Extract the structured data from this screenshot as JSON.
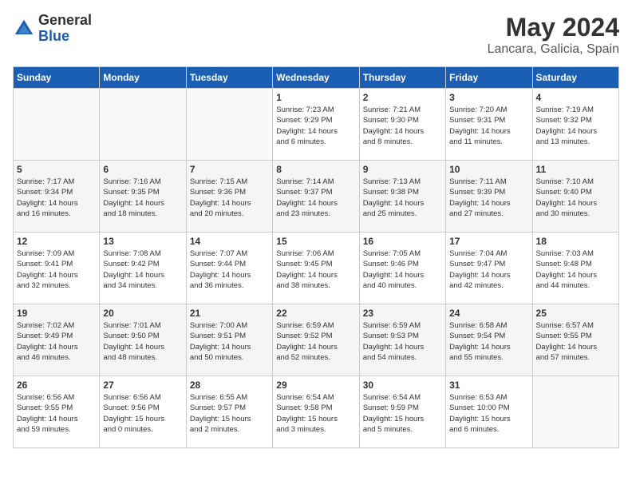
{
  "header": {
    "logo_general": "General",
    "logo_blue": "Blue",
    "main_title": "May 2024",
    "subtitle": "Lancara, Galicia, Spain"
  },
  "calendar": {
    "days_of_week": [
      "Sunday",
      "Monday",
      "Tuesday",
      "Wednesday",
      "Thursday",
      "Friday",
      "Saturday"
    ],
    "weeks": [
      [
        {
          "day": "",
          "info": ""
        },
        {
          "day": "",
          "info": ""
        },
        {
          "day": "",
          "info": ""
        },
        {
          "day": "1",
          "info": "Sunrise: 7:23 AM\nSunset: 9:29 PM\nDaylight: 14 hours\nand 6 minutes."
        },
        {
          "day": "2",
          "info": "Sunrise: 7:21 AM\nSunset: 9:30 PM\nDaylight: 14 hours\nand 8 minutes."
        },
        {
          "day": "3",
          "info": "Sunrise: 7:20 AM\nSunset: 9:31 PM\nDaylight: 14 hours\nand 11 minutes."
        },
        {
          "day": "4",
          "info": "Sunrise: 7:19 AM\nSunset: 9:32 PM\nDaylight: 14 hours\nand 13 minutes."
        }
      ],
      [
        {
          "day": "5",
          "info": "Sunrise: 7:17 AM\nSunset: 9:34 PM\nDaylight: 14 hours\nand 16 minutes."
        },
        {
          "day": "6",
          "info": "Sunrise: 7:16 AM\nSunset: 9:35 PM\nDaylight: 14 hours\nand 18 minutes."
        },
        {
          "day": "7",
          "info": "Sunrise: 7:15 AM\nSunset: 9:36 PM\nDaylight: 14 hours\nand 20 minutes."
        },
        {
          "day": "8",
          "info": "Sunrise: 7:14 AM\nSunset: 9:37 PM\nDaylight: 14 hours\nand 23 minutes."
        },
        {
          "day": "9",
          "info": "Sunrise: 7:13 AM\nSunset: 9:38 PM\nDaylight: 14 hours\nand 25 minutes."
        },
        {
          "day": "10",
          "info": "Sunrise: 7:11 AM\nSunset: 9:39 PM\nDaylight: 14 hours\nand 27 minutes."
        },
        {
          "day": "11",
          "info": "Sunrise: 7:10 AM\nSunset: 9:40 PM\nDaylight: 14 hours\nand 30 minutes."
        }
      ],
      [
        {
          "day": "12",
          "info": "Sunrise: 7:09 AM\nSunset: 9:41 PM\nDaylight: 14 hours\nand 32 minutes."
        },
        {
          "day": "13",
          "info": "Sunrise: 7:08 AM\nSunset: 9:42 PM\nDaylight: 14 hours\nand 34 minutes."
        },
        {
          "day": "14",
          "info": "Sunrise: 7:07 AM\nSunset: 9:44 PM\nDaylight: 14 hours\nand 36 minutes."
        },
        {
          "day": "15",
          "info": "Sunrise: 7:06 AM\nSunset: 9:45 PM\nDaylight: 14 hours\nand 38 minutes."
        },
        {
          "day": "16",
          "info": "Sunrise: 7:05 AM\nSunset: 9:46 PM\nDaylight: 14 hours\nand 40 minutes."
        },
        {
          "day": "17",
          "info": "Sunrise: 7:04 AM\nSunset: 9:47 PM\nDaylight: 14 hours\nand 42 minutes."
        },
        {
          "day": "18",
          "info": "Sunrise: 7:03 AM\nSunset: 9:48 PM\nDaylight: 14 hours\nand 44 minutes."
        }
      ],
      [
        {
          "day": "19",
          "info": "Sunrise: 7:02 AM\nSunset: 9:49 PM\nDaylight: 14 hours\nand 46 minutes."
        },
        {
          "day": "20",
          "info": "Sunrise: 7:01 AM\nSunset: 9:50 PM\nDaylight: 14 hours\nand 48 minutes."
        },
        {
          "day": "21",
          "info": "Sunrise: 7:00 AM\nSunset: 9:51 PM\nDaylight: 14 hours\nand 50 minutes."
        },
        {
          "day": "22",
          "info": "Sunrise: 6:59 AM\nSunset: 9:52 PM\nDaylight: 14 hours\nand 52 minutes."
        },
        {
          "day": "23",
          "info": "Sunrise: 6:59 AM\nSunset: 9:53 PM\nDaylight: 14 hours\nand 54 minutes."
        },
        {
          "day": "24",
          "info": "Sunrise: 6:58 AM\nSunset: 9:54 PM\nDaylight: 14 hours\nand 55 minutes."
        },
        {
          "day": "25",
          "info": "Sunrise: 6:57 AM\nSunset: 9:55 PM\nDaylight: 14 hours\nand 57 minutes."
        }
      ],
      [
        {
          "day": "26",
          "info": "Sunrise: 6:56 AM\nSunset: 9:55 PM\nDaylight: 14 hours\nand 59 minutes."
        },
        {
          "day": "27",
          "info": "Sunrise: 6:56 AM\nSunset: 9:56 PM\nDaylight: 15 hours\nand 0 minutes."
        },
        {
          "day": "28",
          "info": "Sunrise: 6:55 AM\nSunset: 9:57 PM\nDaylight: 15 hours\nand 2 minutes."
        },
        {
          "day": "29",
          "info": "Sunrise: 6:54 AM\nSunset: 9:58 PM\nDaylight: 15 hours\nand 3 minutes."
        },
        {
          "day": "30",
          "info": "Sunrise: 6:54 AM\nSunset: 9:59 PM\nDaylight: 15 hours\nand 5 minutes."
        },
        {
          "day": "31",
          "info": "Sunrise: 6:53 AM\nSunset: 10:00 PM\nDaylight: 15 hours\nand 6 minutes."
        },
        {
          "day": "",
          "info": ""
        }
      ]
    ]
  }
}
